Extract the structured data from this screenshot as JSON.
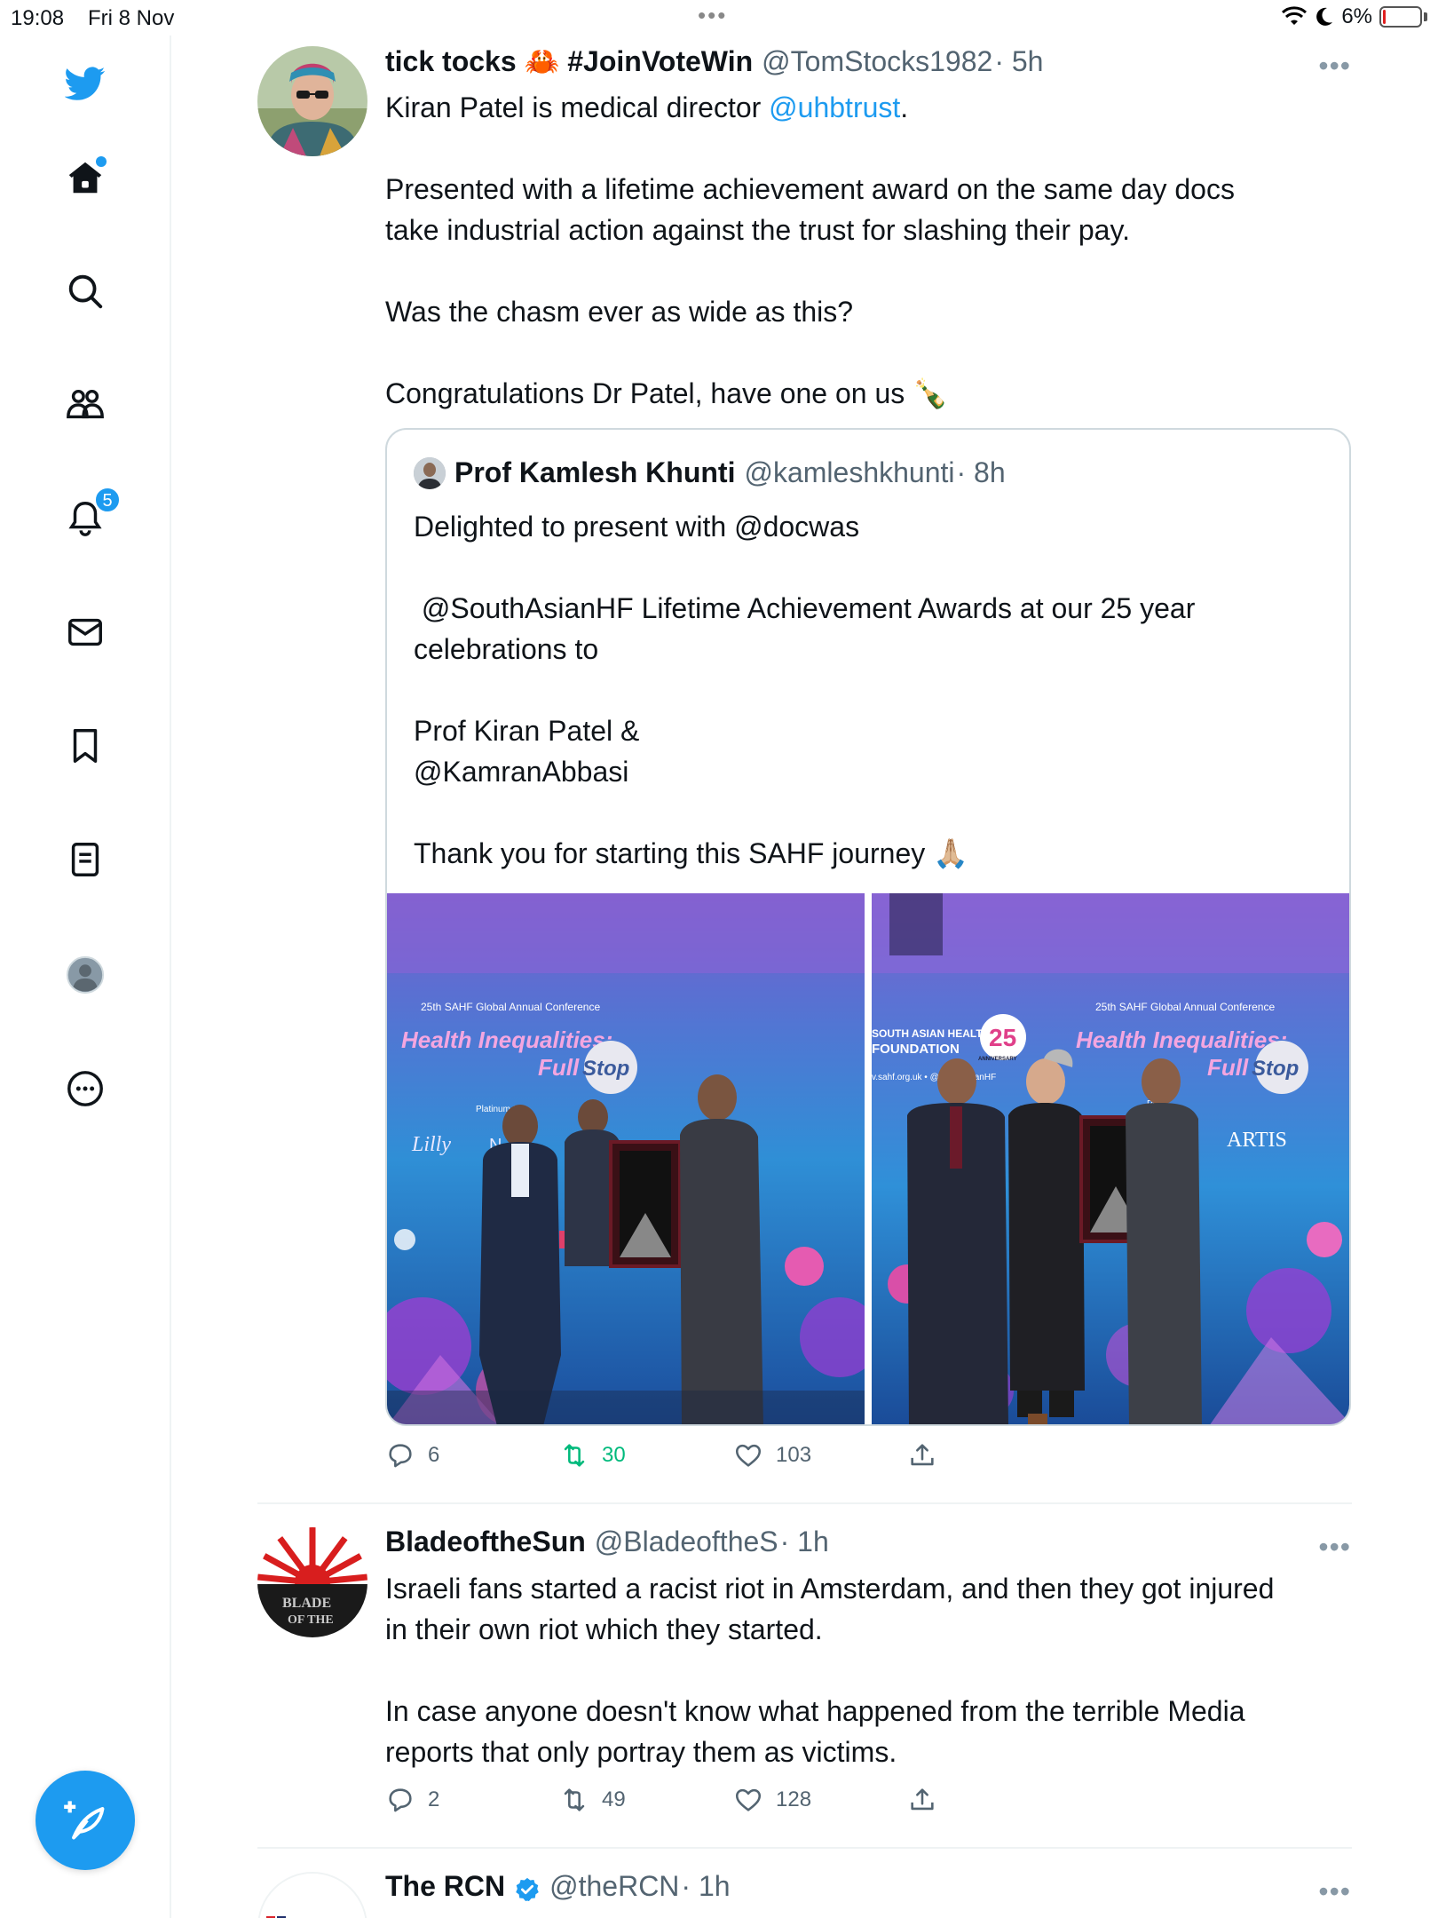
{
  "status_bar": {
    "time": "19:08",
    "date": "Fri 8 Nov",
    "battery": "6%",
    "battery_level": 0.06
  },
  "nav": {
    "logo": "twitter-bird-icon",
    "notifications_count": "5",
    "colors": {
      "accent": "#1d9bf0",
      "retweet": "#00ba7c"
    }
  },
  "tweets": [
    {
      "name": "tick tocks 🦀 #JoinVoteWin",
      "handle": "@TomStocks1982",
      "time": "· 5h",
      "text_lead": "Kiran Patel is medical director ",
      "mention": "@uhbtrust",
      "text_tail": ".",
      "text_body": "Presented with a lifetime achievement award on the same day docs\ntake industrial action against the trust for slashing their pay.\n\nWas the chasm ever as wide as this?\n\nCongratulations Dr Patel, have one on us 🍾",
      "quote": {
        "name": "Prof Kamlesh Khunti",
        "handle": "@kamleshkhunti",
        "time": "· 8h",
        "text": "Delighted to present with @docwas\n\n @SouthAsianHF Lifetime Achievement Awards at our 25 year\ncelebrations to\n\nProf Kiran Patel &\n@KamranAbbasi\n\nThank you for starting this SAHF journey 🙏🏼",
        "photo1": {
          "conference": "25th SAHF Global Annual Conference",
          "title_line1": "Health Inequalities:",
          "title_line2": "Full",
          "title_stop": "Stop",
          "platinum": "Platinum S",
          "sponsor1": "Lilly",
          "sponsor2": "N   AR"
        },
        "photo2": {
          "conference": "25th SAHF Global Annual Conference",
          "title_line1": "Health Inequalities:",
          "title_line2": "Full",
          "title_stop": "Stop",
          "foundation_line1": "SOUTH ASIAN HEALTH",
          "foundation_line2": "FOUNDATION",
          "anniversary": "25",
          "anniversary_sub": "ANNIVERSARY",
          "site": "v.sahf.org.uk • @SouthAsianHF",
          "sponsor": "ARTIS",
          "platinum": "Pl"
        }
      },
      "replies": "6",
      "retweets": "30",
      "likes": "103"
    },
    {
      "name": "BladeoftheSun",
      "handle": "@BladeoftheS",
      "time": "· 1h",
      "avatar_text": "BLADE\nOF THE",
      "text": "Israeli fans started a racist riot in Amsterdam, and then they got injured\nin their own riot which they started.\n\nIn case anyone doesn't know what happened from the terrible Media\nreports that only portray them as victims.",
      "replies": "2",
      "retweets": "49",
      "likes": "128"
    },
    {
      "name": "The RCN",
      "handle": "@theRCN",
      "time": "· 1h",
      "verified": true
    }
  ]
}
